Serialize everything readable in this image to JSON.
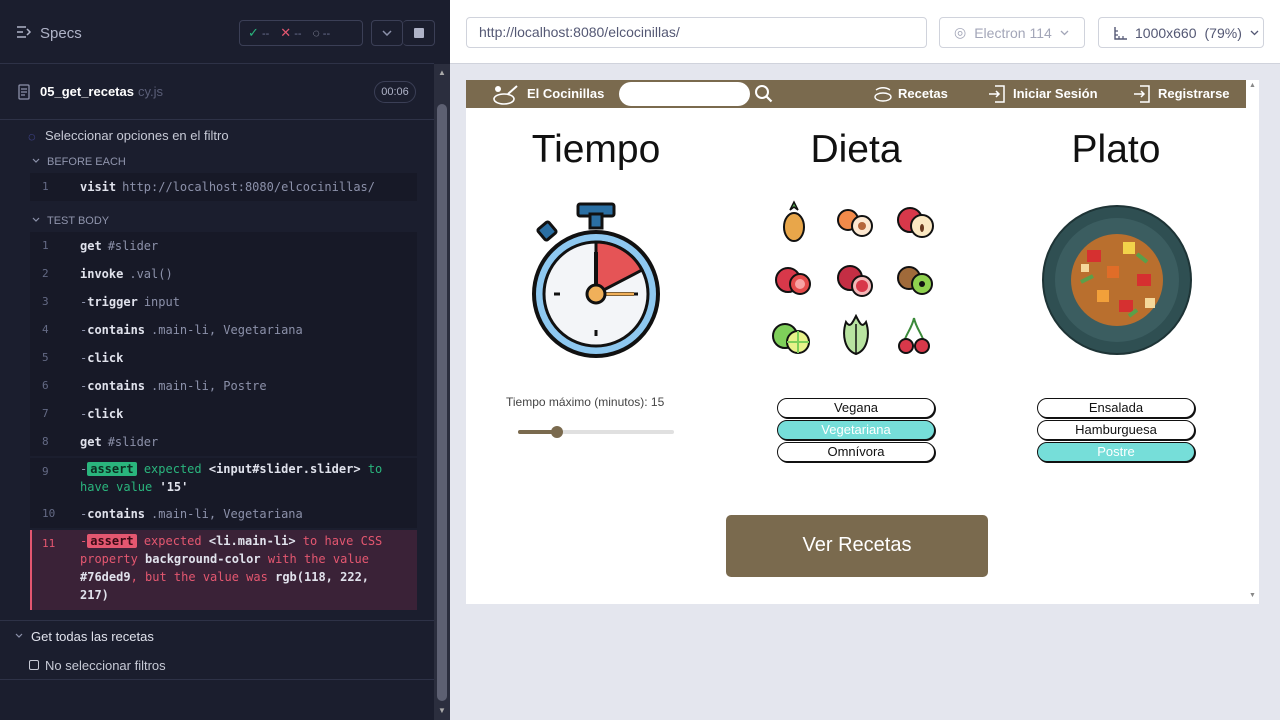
{
  "runner": {
    "title": "Specs",
    "passed": "--",
    "failed": "--",
    "pending": "--",
    "spec_file": "05_get_recetas",
    "spec_ext": "cy.js",
    "duration": "00:06"
  },
  "suite": {
    "test1": "Seleccionar opciones en el filtro",
    "before_each": "BEFORE EACH",
    "test_body": "TEST BODY",
    "test2": "Get todas las recetas",
    "test3": "No seleccionar filtros"
  },
  "before": [
    {
      "n": "1",
      "cmd": "visit",
      "arg": "http://localhost:8080/elcocinillas/"
    }
  ],
  "commands": [
    {
      "n": "1",
      "dash": "",
      "cmd": "get",
      "arg": "#slider"
    },
    {
      "n": "2",
      "dash": "",
      "cmd": "invoke",
      "arg": ".val()"
    },
    {
      "n": "3",
      "dash": "-",
      "cmd": "trigger",
      "arg": "input"
    },
    {
      "n": "4",
      "dash": "-",
      "cmd": "contains",
      "arg": ".main-li, Vegetariana"
    },
    {
      "n": "5",
      "dash": "-",
      "cmd": "click",
      "arg": ""
    },
    {
      "n": "6",
      "dash": "-",
      "cmd": "contains",
      "arg": ".main-li, Postre"
    },
    {
      "n": "7",
      "dash": "-",
      "cmd": "click",
      "arg": ""
    },
    {
      "n": "8",
      "dash": "",
      "cmd": "get",
      "arg": "#slider"
    }
  ],
  "assert_ok": {
    "n": "9",
    "tag": "assert",
    "line1": "expected",
    "el": "<input#slider.slider>",
    "to": "to",
    "line2": "have value",
    "val": "'15'"
  },
  "cmd10": {
    "n": "10",
    "cmd": "contains",
    "arg": ".main-li, Vegetariana"
  },
  "assert_fail": {
    "n": "11",
    "tag": "assert",
    "p1": "expected",
    "el": "<li.main-li>",
    "p2": "to have CSS",
    "p3": "property",
    "prop": "background-color",
    "p4": "with the value",
    "v1": "#76ded9",
    "p5": ", but the value was",
    "v2": "rgb(118, 222,",
    "v3": "217)"
  },
  "browser": {
    "url": "http://localhost:8080/elcocinillas/",
    "engine": "Electron 114",
    "viewport": "1000x660",
    "scale": "(79%)"
  },
  "app": {
    "brand": "El Cocinillas",
    "nav_recetas": "Recetas",
    "nav_login": "Iniciar Sesión",
    "nav_register": "Registrarse",
    "col_time": "Tiempo",
    "col_diet": "Dieta",
    "col_dish": "Plato",
    "slider_label": "Tiempo máximo (minutos): 15",
    "slider_value": 15,
    "diets": [
      "Vegana",
      "Vegetariana",
      "Omnívora"
    ],
    "dishes": [
      "Ensalada",
      "Hamburguesa",
      "Postre"
    ],
    "cta": "Ver Recetas"
  },
  "colors": {
    "accent": "#76ded9",
    "nav": "#7a6a4e",
    "pass": "#2ab57d",
    "fail": "#e45770"
  }
}
